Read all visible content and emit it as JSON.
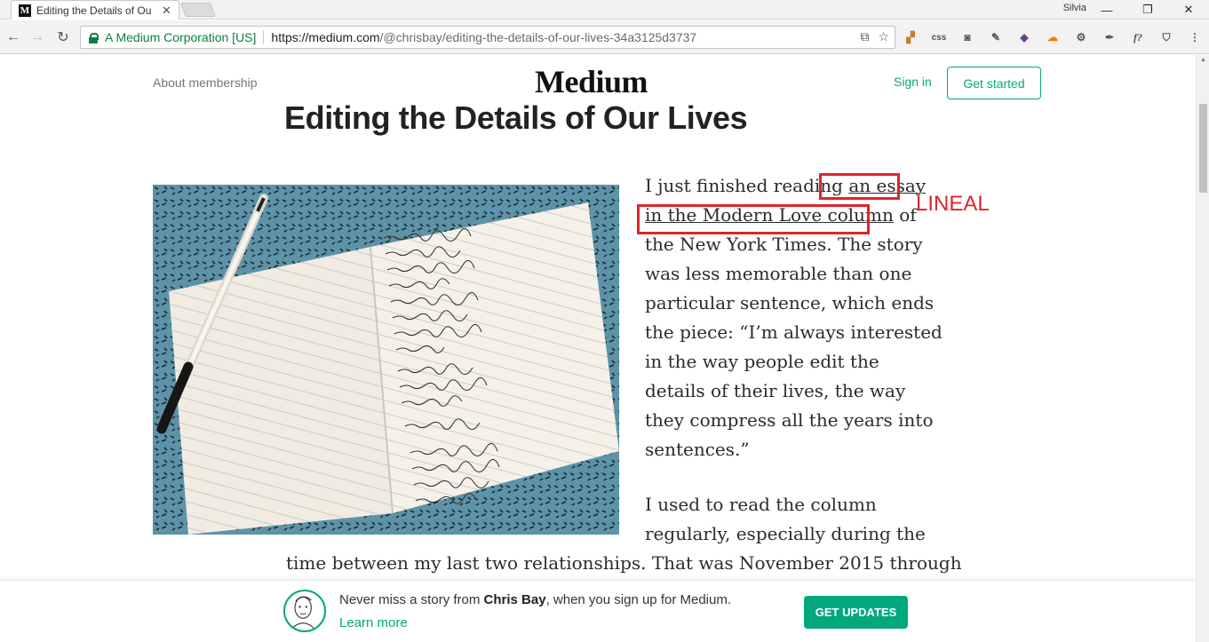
{
  "browser": {
    "tab_title": "Editing the Details of Ou",
    "tab_favicon": "M",
    "user_name": "Silvia",
    "secure_label": "A Medium Corporation [US]",
    "url_host": "https://medium.com",
    "url_path": "/@chrisbay/editing-the-details-of-our-lives-34a3125d3737",
    "extension_css_label": "css",
    "extension_f_label": "f?"
  },
  "header": {
    "about_label": "About membership",
    "logo": "Medium",
    "signin_label": "Sign in",
    "get_started_label": "Get started"
  },
  "article": {
    "title": "Editing the Details of Our Lives",
    "p1": {
      "line1_pre": "I just finished reading ",
      "line1_link": "an essay",
      "line2_link": "in the Modern Love column",
      "line2_post": " of",
      "line3": "the New York Times. The story",
      "line4": "was less memorable than one",
      "line5": "particular sentence, which ends",
      "line6": "the piece: “I’m always interested",
      "line7": "in the way people edit the",
      "line8": "details of their lives, the way",
      "line9": "they compress all the years into",
      "line10": "sentences.”"
    },
    "p2": {
      "line1": "I used to read the column",
      "line2": "regularly, especially during the"
    },
    "p3": {
      "line1": "time between my last two relationships. That was November 2015 through"
    }
  },
  "annotation": {
    "label": "LINEAL",
    "color": "#e0242b"
  },
  "footer": {
    "text_pre": "Never miss a story from ",
    "author": "Chris Bay",
    "text_post": ", when you sign up for Medium.",
    "learn_more": "Learn more",
    "button_label": "GET UPDATES"
  },
  "colors": {
    "accent": "#03a87c",
    "secure": "#0b8043"
  },
  "icons": {
    "back": "arrow-left-icon",
    "forward": "arrow-right-icon",
    "reload": "reload-icon",
    "translate": "translate-icon",
    "bookmark": "star-icon"
  }
}
